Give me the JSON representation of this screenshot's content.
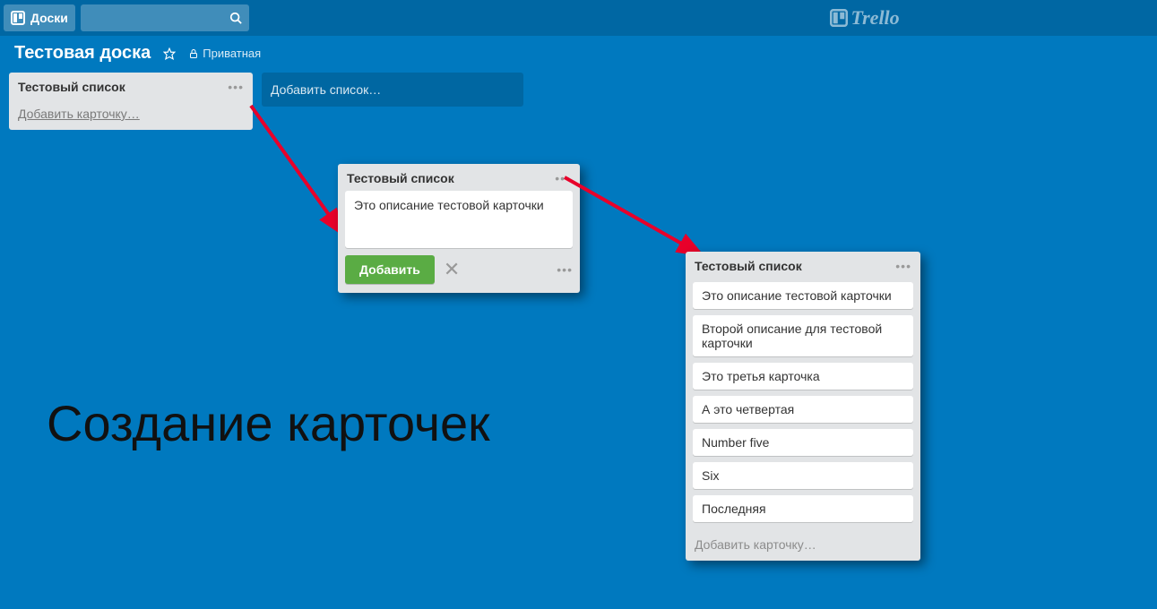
{
  "header": {
    "boards_button": "Доски",
    "brand": "Trello"
  },
  "board": {
    "name": "Тестовая доска",
    "privacy": "Приватная"
  },
  "list_empty": {
    "title": "Тестовый список",
    "add_card": "Добавить карточку…"
  },
  "add_list_placeholder": "Добавить список…",
  "list_compose": {
    "title": "Тестовый список",
    "text": "Это описание тестовой карточки",
    "submit": "Добавить"
  },
  "list_full": {
    "title": "Тестовый список",
    "cards": [
      "Это описание тестовой карточки",
      "Второй описание для тестовой карточки",
      "Это третья карточка",
      "А это четвертая",
      "Number five",
      "Six",
      "Последняя"
    ],
    "add_card": "Добавить карточку…"
  },
  "page_caption": "Создание карточек"
}
